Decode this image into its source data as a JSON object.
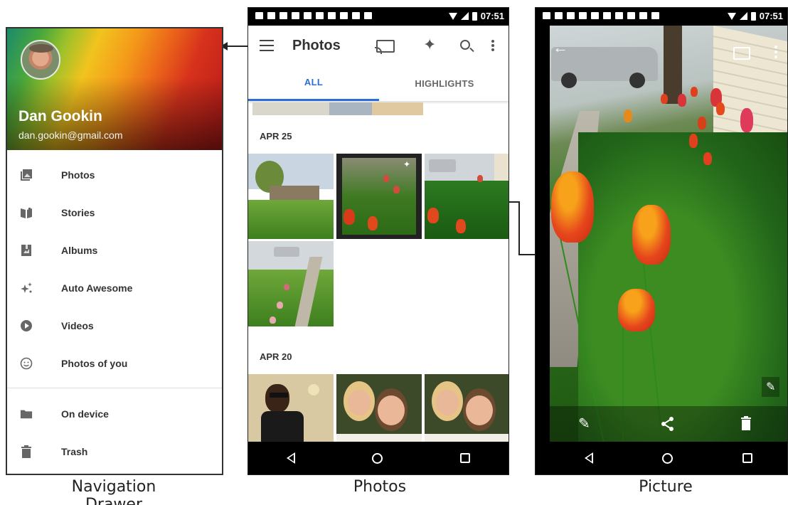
{
  "captions": {
    "drawer": "Navigation Drawer",
    "photos": "Photos",
    "picture": "Picture"
  },
  "drawer": {
    "user_name": "Dan Gookin",
    "user_email": "dan.gookin@gmail.com",
    "items": [
      {
        "label": "Photos",
        "icon": "photos-icon"
      },
      {
        "label": "Stories",
        "icon": "stories-icon"
      },
      {
        "label": "Albums",
        "icon": "albums-icon"
      },
      {
        "label": "Auto Awesome",
        "icon": "auto-awesome-icon"
      },
      {
        "label": "Videos",
        "icon": "videos-icon"
      },
      {
        "label": "Photos of you",
        "icon": "face-icon"
      },
      {
        "label": "On device",
        "icon": "folder-icon"
      },
      {
        "label": "Trash",
        "icon": "trash-icon"
      }
    ]
  },
  "status_bar": {
    "time": "07:51"
  },
  "photos_app": {
    "title": "Photos",
    "tabs": [
      "ALL",
      "HIGHLIGHTS"
    ],
    "active_tab": "ALL",
    "sections": [
      {
        "date": "APR 25",
        "thumbnails": 4
      },
      {
        "date": "APR 20",
        "thumbnails": 3
      }
    ],
    "toolbar_icons": [
      "menu-icon",
      "cast-icon",
      "auto-awesome-icon",
      "search-icon",
      "overflow-menu-icon"
    ]
  },
  "picture_viewer": {
    "toolbar_icons": [
      "back-arrow-icon",
      "cast-icon",
      "overflow-menu-icon"
    ],
    "bottom_icons": [
      "edit-icon",
      "share-icon",
      "delete-icon"
    ],
    "enhance_icon": "auto-fix-icon"
  },
  "colors": {
    "accent": "#2a6fd6",
    "status_bar": "#000000",
    "tulip": "#e0401e"
  }
}
